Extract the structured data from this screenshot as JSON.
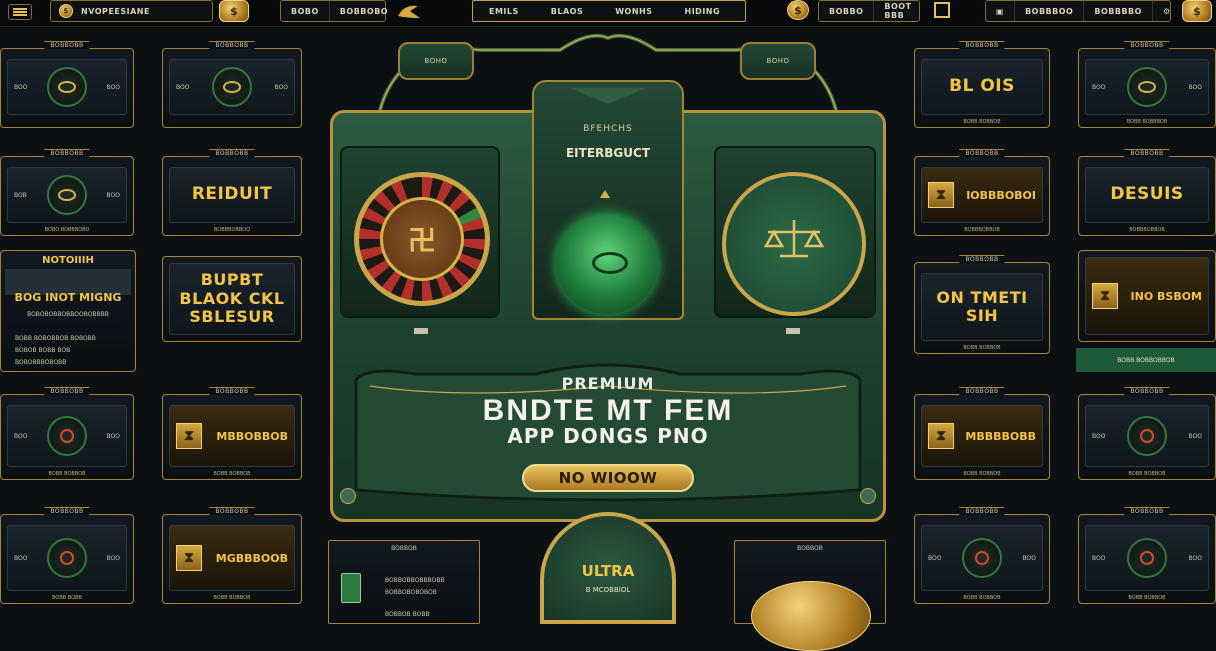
{
  "topbar": {
    "brand": "NVOPEESIANE",
    "group1": [
      "BOBO",
      "BOBBOBO"
    ],
    "nav": [
      "EMILS",
      "BLAOS",
      "WONHS",
      "HIDING"
    ],
    "group2": [
      "BOBBO",
      "BOOT BBB"
    ],
    "group3": [
      "BOBBBOO",
      "BOBBBBO"
    ]
  },
  "center": {
    "left_tab": "BOHO",
    "right_tab": "BOHO",
    "subtitle": "BFEHCHS",
    "title_small": "EITERBGUCT",
    "headline_small": "PREMIUM",
    "headline_big": "BNDTE MT FEM",
    "headline_sub": "APP DONGS PNO",
    "cta_label": "NO WIOOW",
    "ultra_label": "ULTRA",
    "ultra_sub": "B MCOBBIOL"
  },
  "left_column": {
    "card1": {
      "tab": "BOBBOBB",
      "l": "BOO",
      "r": "BOO",
      "foot": ""
    },
    "card2": {
      "tab": "BOBBOBB",
      "l": "BOB",
      "r": "BOO",
      "foot": ""
    },
    "card3": {
      "tab": "BOBBOBB",
      "l": "BOB",
      "r": "BOO",
      "foot": "BOBO BOBBBOBO"
    },
    "card4": {
      "tab": "BOBBOBB",
      "big": "REIDUIT",
      "foot": "BOBBBOBBOO"
    },
    "notice": {
      "title": "NOTOIIIH",
      "big": "BOG INOT MIGNG",
      "sub": "BOBOBOBBOBBOOBOBBBB",
      "lines": [
        "BOBB BOBOBBOB BOBOBB",
        "BOBOB BOBB BOB",
        "BOBOBBBOBOBB"
      ]
    },
    "card5": {
      "big": "BUPBT BLAOK CKL SBLESUR"
    },
    "card6": {
      "tab": "BOBBOBB",
      "l": "BOO",
      "r": "BOO",
      "foot": "BOBB BOBBOB"
    },
    "card7": {
      "tab": "BOBBOBB",
      "label": "MBBOBBOB",
      "foot": "BOBB BOBBOB"
    },
    "card8": {
      "tab": "BOBBOBB",
      "l": "BOO",
      "r": "BOO",
      "foot": "BOBB BOBB"
    },
    "card9": {
      "tab": "BOBBOBB",
      "label": "MGBBBOOB",
      "foot": "BOBB BOBBOB"
    }
  },
  "right_column": {
    "r1a": {
      "tab": "BOBBOBB",
      "big": "BL OIS",
      "foot": "BOBB BOBBOB"
    },
    "r1b": {
      "tab": "BOBBOBB",
      "l": "BOO",
      "r": "BOO",
      "foot": "BOBB BOBBBOB"
    },
    "r2a": {
      "tab": "BOBBOBB",
      "label": "IOBBBOBOI",
      "foot": "BOBBBOBBOB"
    },
    "r2b": {
      "tab": "BOBBOBB",
      "big": "DESUIS",
      "foot": "BOBBBOBBOB"
    },
    "r3a": {
      "tab": "BOBBOBB",
      "big": "ON TMETI SIH",
      "foot": "BOBB BOBBOB"
    },
    "r3b": {
      "label": "INO BSBOM",
      "bar": "BOBB BOBBOBBOB"
    },
    "r4a": {
      "tab": "BOBBOBB",
      "label": "MBBBBOBB",
      "foot": "BOBB BOBBOB"
    },
    "r4b": {
      "tab": "BOBBOBB",
      "l": "BOO",
      "r": "BOO",
      "foot": "BOBB BOBBOB"
    },
    "r5a": {
      "tab": "BOBBOBB",
      "l": "BOO",
      "r": "BOO",
      "foot": "BOBB BOBBOB"
    },
    "r5b": {
      "tab": "BOBBOBB",
      "l": "BOO",
      "r": "BOO",
      "foot": "BOBB BOBBOB"
    }
  },
  "bottom_center": {
    "left_title": "BOBBOB",
    "left_lines": [
      "BOBBOBBOBBBOBB",
      "BOBBOBOBOBOB",
      "BOBBOB BOBB"
    ],
    "right_title": "BOBBOB"
  },
  "colors": {
    "gold": "#e6c160",
    "green": "#2a5a40",
    "background": "#0c1013"
  }
}
